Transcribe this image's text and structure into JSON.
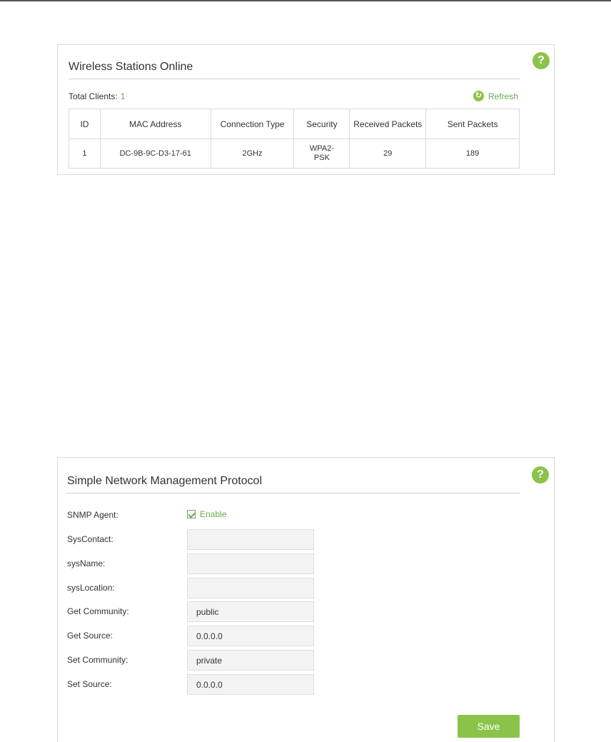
{
  "wireless": {
    "title": "Wireless Stations Online",
    "help_glyph": "?",
    "total_clients_label": "Total Clients:",
    "total_clients_value": "1",
    "refresh_label": "Refresh",
    "columns": [
      "ID",
      "MAC Address",
      "Connection Type",
      "Security",
      "Received Packets",
      "Sent Packets"
    ],
    "rows": [
      {
        "id": "1",
        "mac": "DC-9B-9C-D3-17-61",
        "connection": "2GHz",
        "security_line1": "WPA2-",
        "security_line2": "PSK",
        "received": "29",
        "sent": "189"
      }
    ]
  },
  "snmp": {
    "title": "Simple Network Management Protocol",
    "help_glyph": "?",
    "agent_label": "SNMP Agent:",
    "agent_enable_label": "Enable",
    "agent_enabled": true,
    "fields": {
      "syscontact": {
        "label": "SysContact:",
        "value": ""
      },
      "sysname": {
        "label": "sysName:",
        "value": ""
      },
      "syslocation": {
        "label": "sysLocation:",
        "value": ""
      },
      "get_community": {
        "label": "Get Community:",
        "value": "public"
      },
      "get_source": {
        "label": "Get Source:",
        "value": "0.0.0.0"
      },
      "set_community": {
        "label": "Set Community:",
        "value": "private"
      },
      "set_source": {
        "label": "Set Source:",
        "value": "0.0.0.0"
      }
    },
    "save_label": "Save"
  },
  "colors": {
    "accent": "#8bc34a",
    "accent_text": "#6aa84f",
    "border": "#d9d9d9",
    "input_bg": "#f3f3f3"
  },
  "icons": {
    "help": "help-icon",
    "refresh": "refresh-icon",
    "checkbox": "checkbox-checked-icon"
  }
}
